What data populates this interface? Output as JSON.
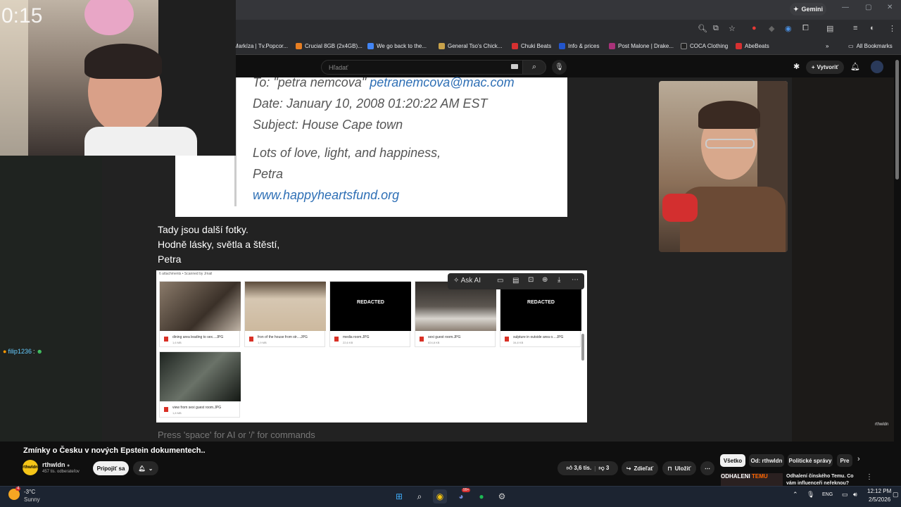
{
  "browser": {
    "gemini_label": "Gemini",
    "bookmarks": [
      {
        "label": "Markíza | Tv.Popcor...",
        "color": "#c0392b"
      },
      {
        "label": "Crucial 8GB (2x4GB)...",
        "color": "#e67e22"
      },
      {
        "label": "We go back to the...",
        "color": "#4285f4"
      },
      {
        "label": "General Tso's Chick...",
        "color": "#c8a24a"
      },
      {
        "label": "Chuki Beats",
        "color": "#d63031"
      },
      {
        "label": "Info & prices",
        "color": "#2255cc"
      },
      {
        "label": "Post Malone | Drake...",
        "color": "#a83279"
      },
      {
        "label": "COCA Clothing",
        "color": "#222222"
      },
      {
        "label": "AbeBeats",
        "color": "#d63031"
      }
    ],
    "all_bookmarks": "All Bookmarks"
  },
  "youtube": {
    "search_placeholder": "Hľadať",
    "create_label": "Vytvoriť",
    "video_title": "Zmínky o Česku v nových Epstein dokumentech..",
    "channel_name": "rthwldn",
    "channel_avatar_text": "rthwldn",
    "subscribers": "457 tis. odberateľov",
    "join_label": "Pripojiť sa",
    "likes": "3,6 tis.",
    "dislikes": "3",
    "share_label": "Zdieľať",
    "save_label": "Uložiť",
    "chips": [
      "Všetko",
      "Od: rthwldn",
      "Politické správy",
      "Pre"
    ],
    "rec_title": "Odhalení čínského Temu. Co vám influenceři neřeknou?",
    "rec_thumb_text": "ODHALENI",
    "rec_thumb_brand": "TEMU"
  },
  "video_content": {
    "email_to_prefix": "To: \"petra nemcova\"",
    "email_to_addr": "petranemcova@mac.com",
    "email_date": "Date: January 10, 2008 01:20:22 AM EST",
    "email_subject": "Subject: House Cape town",
    "email_love": "Lots of love, light, and happiness,",
    "email_sign": "Petra",
    "email_link": "www.happyheartsfund.org",
    "body_line1": "Tady jsou další fotky.",
    "body_line2": "Hodně lásky, světla a štěstí,",
    "body_line3": "Petra",
    "attachments_header": "6 attachments • Scanned by Jmail",
    "attachments": [
      {
        "name": "dining area leading to sex....JPG",
        "size": "1,6 MB",
        "redacted": false,
        "color": "#5a5048"
      },
      {
        "name": "fron of the house from str....JPG",
        "size": "1,9 MB",
        "redacted": false,
        "color": "#c9b8a2"
      },
      {
        "name": "media room.JPG",
        "size": "22,6 KB",
        "redacted": true,
        "color": "#000000"
      },
      {
        "name": "sexi guest room.JPG",
        "size": "824,8 KB",
        "redacted": false,
        "color": "#6b6660"
      },
      {
        "name": "sulpture in outside area o....JPG",
        "size": "34,8 KB",
        "redacted": true,
        "color": "#000000"
      },
      {
        "name": "view from sexi guest room.JPG",
        "size": "1,8 MB",
        "redacted": false,
        "color": "#2f3530"
      }
    ],
    "redacted_label": "REDACTED",
    "ask_ai_label": "Ask AI",
    "editor_placeholder": "Press 'space' for AI or '/' for commands",
    "stream_overlay_timer": "0:15",
    "watermark": "rthwldn"
  },
  "chat": {
    "user": "filip1236",
    "separator": ":"
  },
  "taskbar": {
    "temperature": "-3°C",
    "weather": "Sunny",
    "weather_badge": "4",
    "language": "ENG",
    "time": "12:12 PM",
    "date": "2/5/2026",
    "discord_badge": "99+"
  }
}
